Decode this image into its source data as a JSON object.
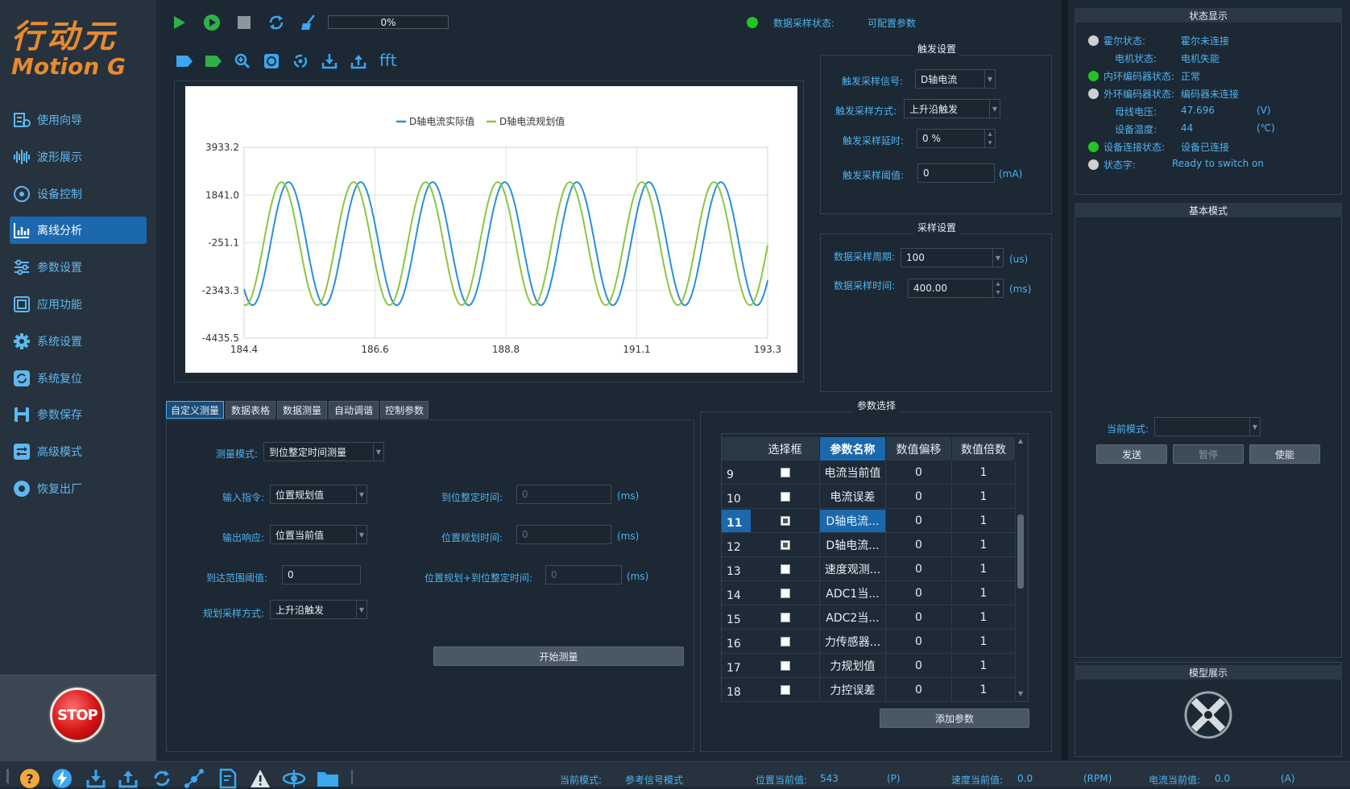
{
  "logo": {
    "line1": "行动元",
    "line2": "Motion G"
  },
  "sidebar": {
    "items": [
      {
        "label": "使用向导",
        "icon": "guide-icon"
      },
      {
        "label": "波形展示",
        "icon": "waveform-icon"
      },
      {
        "label": "设备控制",
        "icon": "device-control-icon"
      },
      {
        "label": "离线分析",
        "icon": "chart-icon"
      },
      {
        "label": "参数设置",
        "icon": "sliders-icon"
      },
      {
        "label": "应用功能",
        "icon": "app-icon"
      },
      {
        "label": "系统设置",
        "icon": "gear-icon"
      },
      {
        "label": "系统复位",
        "icon": "reset-icon"
      },
      {
        "label": "参数保存",
        "icon": "save-icon"
      },
      {
        "label": "高级模式",
        "icon": "advanced-icon"
      },
      {
        "label": "恢复出厂",
        "icon": "factory-reset-icon"
      }
    ],
    "active_index": 3,
    "stop_label": "STOP"
  },
  "toolbar": {
    "progress": "0%",
    "progress_value": 0,
    "fft_label": "fft"
  },
  "sampling_status": {
    "label": "数据采样状态:",
    "value": "可配置参数",
    "color": "#22c322"
  },
  "chart_data": {
    "type": "line",
    "title": "",
    "xlabel": "",
    "ylabel": "",
    "xlim": [
      184.4,
      193.3
    ],
    "ylim": [
      -4435.5,
      3933.2
    ],
    "x_ticks": [
      "184.4",
      "186.6",
      "188.8",
      "191.1",
      "193.3"
    ],
    "y_ticks": [
      "3933.2",
      "1841.0",
      "-251.1",
      "-2343.3",
      "-4435.5"
    ],
    "grid": true,
    "legend": "top-center",
    "series": [
      {
        "name": "D轴电流实际值",
        "color": "#2a8fd8",
        "amplitude": 2700,
        "offset": -290,
        "period": 1.225,
        "phase": 184.85
      },
      {
        "name": "D轴电流规划值",
        "color": "#8cc63f",
        "amplitude": 2700,
        "offset": -290,
        "period": 1.225,
        "phase": 184.73
      }
    ]
  },
  "trigger": {
    "title": "触发设置",
    "signal_label": "触发采样信号:",
    "signal_value": "D轴电流",
    "mode_label": "触发采样方式:",
    "mode_value": "上升沿触发",
    "delay_label": "触发采样延时:",
    "delay_value": "0 %",
    "threshold_label": "触发采样阈值:",
    "threshold_value": "0",
    "threshold_unit": "(mA)"
  },
  "sampling": {
    "title": "采样设置",
    "period_label": "数据采样周期:",
    "period_value": "100",
    "period_unit": "(us)",
    "time_label": "数据采样时间:",
    "time_value": "400.00",
    "time_unit": "(ms)"
  },
  "tabs": [
    "自定义测量",
    "数据表格",
    "数据测量",
    "自动调谐",
    "控制参数"
  ],
  "measure": {
    "mode_label": "测量模式:",
    "mode_value": "到位整定时间测量",
    "input_label": "输入指令:",
    "input_value": "位置规划值",
    "output_label": "输出响应:",
    "output_value": "位置当前值",
    "range_label": "到达范围阈值:",
    "range_value": "0",
    "plan_mode_label": "规划采样方式:",
    "plan_mode_value": "上升沿触发",
    "settle_label": "到位整定时间:",
    "settle_value": "0",
    "settle_unit": "(ms)",
    "plan_time_label": "位置规划时间:",
    "plan_time_value": "0",
    "plan_time_unit": "(ms)",
    "total_label": "位置规划+到位整定时间:",
    "total_value": "0",
    "total_unit": "(ms)",
    "start_button": "开始测量"
  },
  "params": {
    "title": "参数选择",
    "headers": [
      "选择框",
      "参数名称",
      "数值偏移",
      "数值倍数"
    ],
    "rows": [
      {
        "n": "9",
        "checked": false,
        "name": "电流当前值",
        "offset": "0",
        "scale": "1"
      },
      {
        "n": "10",
        "checked": false,
        "name": "电流误差",
        "offset": "0",
        "scale": "1"
      },
      {
        "n": "11",
        "checked": true,
        "name": "D轴电流...",
        "offset": "0",
        "scale": "1"
      },
      {
        "n": "12",
        "checked": true,
        "name": "D轴电流...",
        "offset": "0",
        "scale": "1"
      },
      {
        "n": "13",
        "checked": false,
        "name": "速度观测...",
        "offset": "0",
        "scale": "1"
      },
      {
        "n": "14",
        "checked": false,
        "name": "ADC1当...",
        "offset": "0",
        "scale": "1"
      },
      {
        "n": "15",
        "checked": false,
        "name": "ADC2当...",
        "offset": "0",
        "scale": "1"
      },
      {
        "n": "16",
        "checked": false,
        "name": "力传感器...",
        "offset": "0",
        "scale": "1"
      },
      {
        "n": "17",
        "checked": false,
        "name": "力规划值",
        "offset": "0",
        "scale": "1"
      },
      {
        "n": "18",
        "checked": false,
        "name": "力控误差",
        "offset": "0",
        "scale": "1"
      }
    ],
    "selected_row": "11",
    "add_button": "添加参数"
  },
  "status": {
    "title": "状态显示",
    "rows": [
      {
        "label": "霍尔状态:",
        "value": "霍尔未连接",
        "unit": "",
        "dot": "#d0d0d0"
      },
      {
        "label": "电机状态:",
        "value": "电机失能",
        "unit": "",
        "dot": ""
      },
      {
        "label": "内环编码器状态:",
        "value": "正常",
        "unit": "",
        "dot": "#22c322"
      },
      {
        "label": "外环编码器状态:",
        "value": "编码器未连接",
        "unit": "",
        "dot": "#d0d0d0"
      },
      {
        "label": "母线电压:",
        "value": "47.696",
        "unit": "(V)",
        "dot": ""
      },
      {
        "label": "设备温度:",
        "value": "44",
        "unit": "(℃)",
        "dot": ""
      },
      {
        "label": "设备连接状态:",
        "value": "设备已连接",
        "unit": "",
        "dot": "#22c322"
      },
      {
        "label": "状态字:",
        "value": "Ready to switch on",
        "unit": "",
        "dot": "#d0d0d0"
      }
    ]
  },
  "basic_mode": {
    "title": "基本模式",
    "current_mode_label": "当前模式:",
    "current_mode_value": "",
    "send": "发送",
    "pause": "暂停",
    "enable": "使能"
  },
  "model": {
    "title": "模型展示"
  },
  "bottom": {
    "mode_label": "当前模式:",
    "mode_value": "参考信号模式",
    "pos_label": "位置当前值:",
    "pos_value": "543",
    "pos_unit": "(P)",
    "speed_label": "速度当前值:",
    "speed_value": "0.0",
    "speed_unit": "(RPM)",
    "current_label": "电流当前值:",
    "current_value": "0.0",
    "current_unit": "(A)"
  }
}
